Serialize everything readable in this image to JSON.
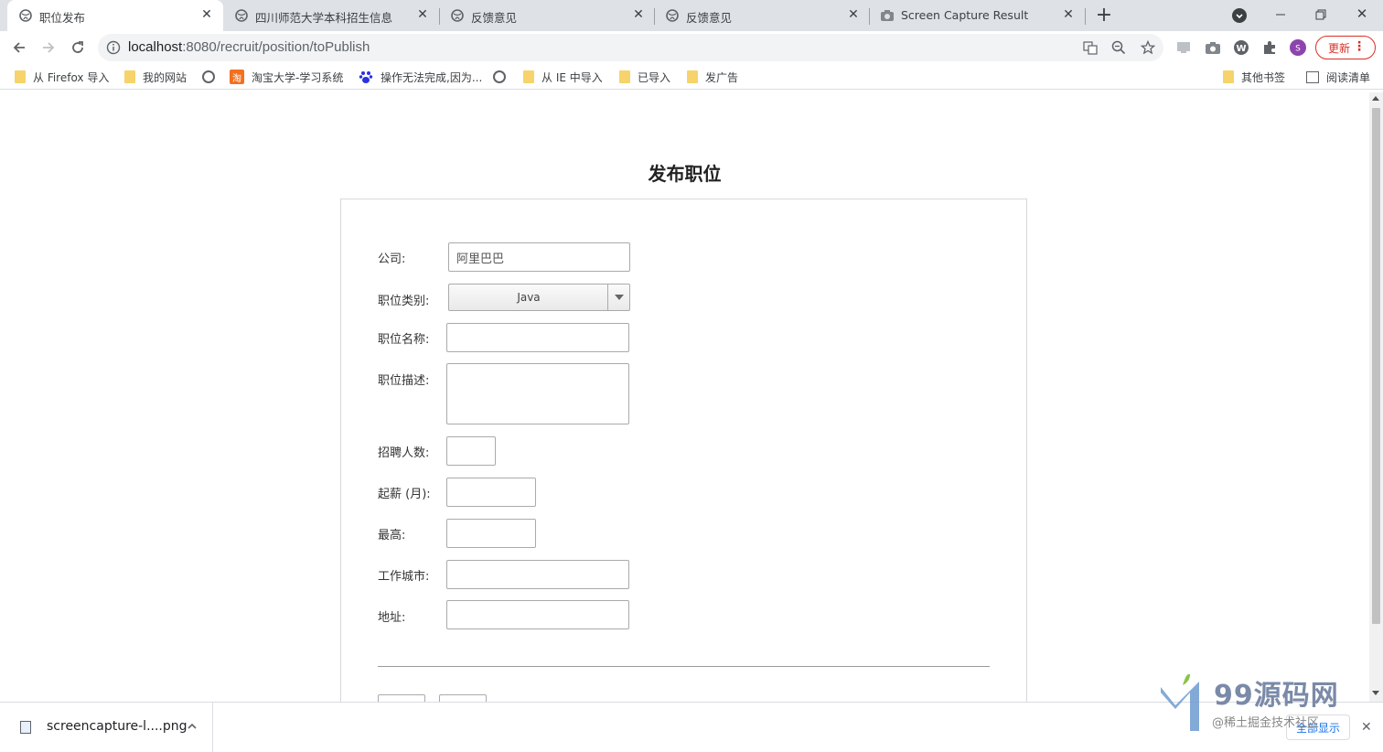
{
  "browser": {
    "tabs": [
      {
        "title": "职位发布",
        "active": true
      },
      {
        "title": "四川师范大学本科招生信息网",
        "active": false
      },
      {
        "title": "反馈意见",
        "active": false
      },
      {
        "title": "反馈意见",
        "active": false
      },
      {
        "title": "Screen Capture Result",
        "active": false
      }
    ],
    "url_host": "localhost",
    "url_path": ":8080/recruit/position/toPublish",
    "update_label": "更新",
    "profile_initial": "S",
    "bookmarks": [
      "从 Firefox 导入",
      "我的网站",
      "淘宝大学-学习系统",
      "操作无法完成,因为...",
      "从 IE 中导入",
      "已导入",
      "发广告"
    ],
    "bookmarks_right": [
      "其他书签",
      "阅读清单"
    ],
    "taobao_badge": "淘"
  },
  "page": {
    "title": "发布职位",
    "form": {
      "company_label": "公司:",
      "company_value": "阿里巴巴",
      "category_label": "职位类别:",
      "category_value": "Java",
      "name_label": "职位名称:",
      "desc_label": "职位描述:",
      "headcount_label": "招聘人数:",
      "salary_min_label": "起薪 (月):",
      "salary_max_label": "最高:",
      "city_label": "工作城市:",
      "address_label": "地址:"
    }
  },
  "downloads": {
    "file_name": "screencapture-l....png",
    "show_all": "全部显示"
  },
  "watermark": {
    "text": "99源码网",
    "sub": "@稀土掘金技术社区"
  }
}
